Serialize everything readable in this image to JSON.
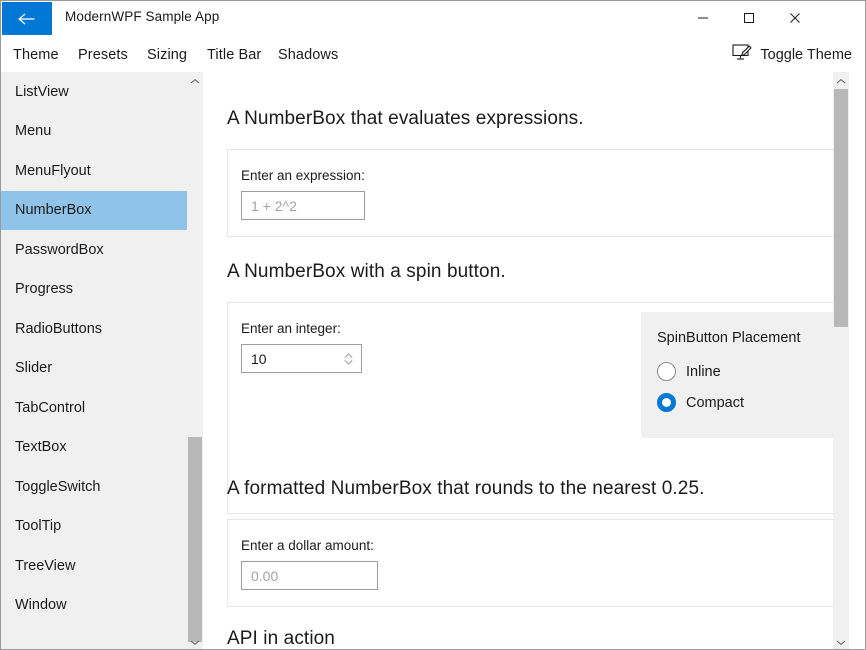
{
  "window": {
    "title": "ModernWPF Sample App",
    "accent_color": "#0078d4",
    "selection_color": "#8fc3e8",
    "panel_color": "#f0f0f0"
  },
  "titlebar": {
    "back_icon": "back-arrow-icon",
    "minimize_label": "minimize-icon",
    "maximize_label": "maximize-icon",
    "close_label": "close-icon"
  },
  "menubar": {
    "items": [
      {
        "label": "Theme"
      },
      {
        "label": "Presets"
      },
      {
        "label": "Sizing"
      },
      {
        "label": "Title Bar"
      },
      {
        "label": "Shadows"
      }
    ],
    "toggle_theme": {
      "label": "Toggle Theme",
      "icon": "personalize-icon"
    }
  },
  "sidebar": {
    "selected": "NumberBox",
    "items": [
      {
        "label": "ListView"
      },
      {
        "label": "Menu"
      },
      {
        "label": "MenuFlyout"
      },
      {
        "label": "NumberBox"
      },
      {
        "label": "PasswordBox"
      },
      {
        "label": "Progress"
      },
      {
        "label": "RadioButtons"
      },
      {
        "label": "Slider"
      },
      {
        "label": "TabControl"
      },
      {
        "label": "TextBox"
      },
      {
        "label": "ToggleSwitch"
      },
      {
        "label": "ToolTip"
      },
      {
        "label": "TreeView"
      },
      {
        "label": "Window"
      }
    ],
    "scrollbar": {
      "up_icon": "chevron-up-icon",
      "down_icon": "chevron-down-icon"
    }
  },
  "content": {
    "section1": {
      "title": "A NumberBox that evaluates expressions.",
      "field_label": "Enter an expression:",
      "input_placeholder": "1 + 2^2",
      "input_value": ""
    },
    "section2": {
      "title": "A NumberBox with a spin button.",
      "field_label": "Enter an integer:",
      "input_value": "10",
      "spin_icon": "spinner-updown-icon",
      "option_panel": {
        "title": "SpinButton Placement",
        "options": [
          {
            "label": "Inline",
            "checked": false
          },
          {
            "label": "Compact",
            "checked": true
          }
        ]
      }
    },
    "section3": {
      "title": "A formatted NumberBox that rounds to the nearest 0.25.",
      "field_label": "Enter a dollar amount:",
      "input_placeholder": "0.00",
      "input_value": ""
    },
    "section4": {
      "title": "API in action"
    },
    "scrollbar": {
      "up_icon": "chevron-up-icon",
      "down_icon": "chevron-down-icon"
    }
  }
}
